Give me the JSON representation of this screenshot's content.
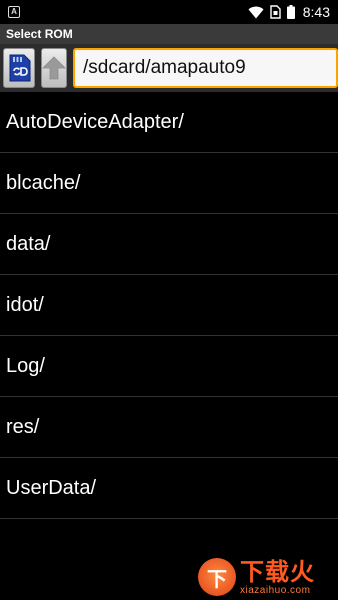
{
  "status_bar": {
    "notification_icon": "A",
    "time": "8:43",
    "icons": [
      "notification-a-icon",
      "wifi-icon",
      "sim-card-icon",
      "battery-icon"
    ]
  },
  "title": "Select ROM",
  "toolbar": {
    "sd_card_icon": "sd-card-icon",
    "up_icon": "arrow-up-icon",
    "path": "/sdcard/amapauto9"
  },
  "files": [
    {
      "name": "AutoDeviceAdapter/"
    },
    {
      "name": "blcache/"
    },
    {
      "name": "data/"
    },
    {
      "name": "idot/"
    },
    {
      "name": "Log/"
    },
    {
      "name": "res/"
    },
    {
      "name": "UserData/"
    }
  ],
  "watermark": {
    "logo": "下",
    "text": "下载火",
    "url": "xiazaihuo.com"
  },
  "colors": {
    "background": "#000000",
    "toolbar": "#2c2c2c",
    "title_bar": "#3a3a3a",
    "path_border": "#ffa200",
    "watermark": "#ff5a1f"
  }
}
